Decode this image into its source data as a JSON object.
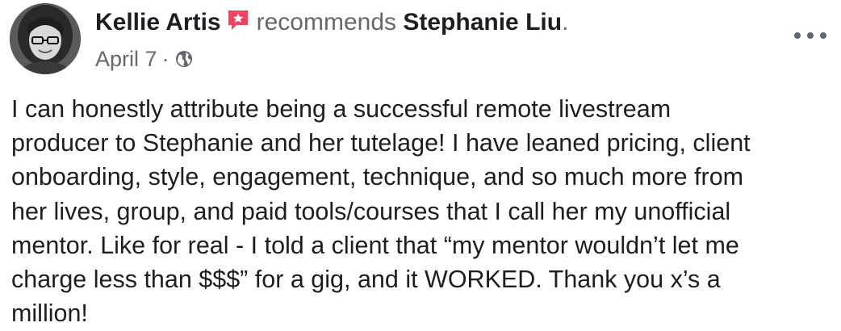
{
  "post": {
    "author": "Kellie Artis",
    "action": "recommends",
    "target": "Stephanie Liu",
    "target_suffix": ".",
    "date": "April 7",
    "separator": "·",
    "privacy_icon": "globe-icon",
    "more_icon": "more-options-icon",
    "badge_icon": "recommendation-star-icon",
    "body": "I can honestly attribute being a successful remote livestream\nproducer to Stephanie and her tutelage! I have leaned pricing, client\nonboarding, style, engagement, technique, and so much more from\nher lives, group, and paid tools/courses that I call her my unofficial\nmentor. Like for real - I told a client that “my mentor wouldn’t let me\ncharge less than $$$” for a gig, and it WORKED. Thank you x’s a\nmillion!"
  },
  "colors": {
    "badge": "#f3425f",
    "secondary_text": "#65676b",
    "primary_text": "#1c1e21"
  }
}
